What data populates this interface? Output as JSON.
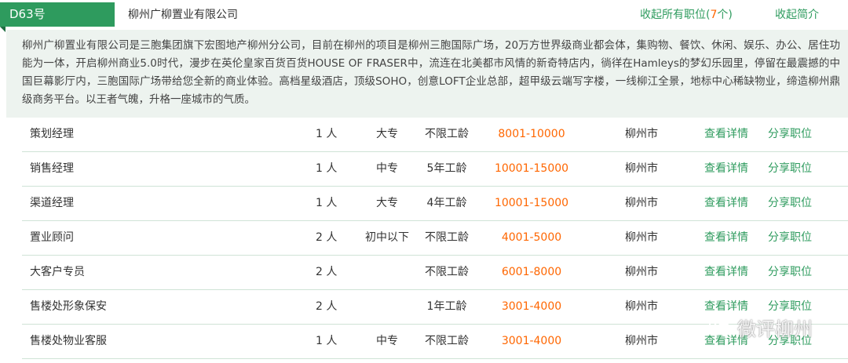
{
  "header": {
    "tag": "D63号",
    "company": "柳州广柳置业有限公司",
    "collapse_all_prefix": "收起所有职位(",
    "collapse_all_count": "7",
    "collapse_all_suffix": "个)",
    "collapse_intro": "收起简介"
  },
  "intro": {
    "text": "柳州广柳置业有限公司是三胞集团旗下宏图地产柳州分公司，目前在柳州的项目是柳州三胞国际广场，20万方世界级商业都会体，集购物、餐饮、休闲、娱乐、办公、居住功能为一体，开启柳州商业5.0时代，漫步在英伦皇家百货百货HOUSE OF FRASER中，流连在北美都市风情的新奇特店内，徜徉在Hamleys的梦幻乐园里，停留在最震撼的中国巨幕影厅内，三胞国际广场带给您全新的商业体验。高档星级酒店，顶级SOHO，创意LOFT企业总部，超甲级云端写字楼，一线柳江全景，地标中心稀缺物业，缔造柳州鼎级商务平台。以王者气魄，升格一座城市的气质。"
  },
  "jobs": [
    {
      "title": "策划经理",
      "count": "1 人",
      "edu": "大专",
      "exp": "不限工龄",
      "salary": "8001-10000",
      "city": "柳州市",
      "detail": "查看详情",
      "share": "分享职位"
    },
    {
      "title": "销售经理",
      "count": "1 人",
      "edu": "中专",
      "exp": "5年工龄",
      "salary": "10001-15000",
      "city": "柳州市",
      "detail": "查看详情",
      "share": "分享职位"
    },
    {
      "title": "渠道经理",
      "count": "1 人",
      "edu": "大专",
      "exp": "4年工龄",
      "salary": "10001-15000",
      "city": "柳州市",
      "detail": "查看详情",
      "share": "分享职位"
    },
    {
      "title": "置业顾问",
      "count": "2 人",
      "edu": "初中以下",
      "exp": "不限工龄",
      "salary": "4001-5000",
      "city": "柳州市",
      "detail": "查看详情",
      "share": "分享职位"
    },
    {
      "title": "大客户专员",
      "count": "2 人",
      "edu": "",
      "exp": "不限工龄",
      "salary": "6001-8000",
      "city": "柳州市",
      "detail": "查看详情",
      "share": "分享职位"
    },
    {
      "title": "售楼处形象保安",
      "count": "2 人",
      "edu": "",
      "exp": "1年工龄",
      "salary": "3001-4000",
      "city": "柳州市",
      "detail": "查看详情",
      "share": "分享职位"
    },
    {
      "title": "售楼处物业客服",
      "count": "1 人",
      "edu": "中专",
      "exp": "不限工龄",
      "salary": "3001-4000",
      "city": "柳州市",
      "detail": "查看详情",
      "share": "分享职位"
    }
  ],
  "watermark": {
    "text": "微评柳州",
    "icon": "wechat-icon"
  },
  "colors": {
    "accent": "#2e9b5e",
    "salary": "#ff6600",
    "intro_bg": "#edf3ef"
  }
}
